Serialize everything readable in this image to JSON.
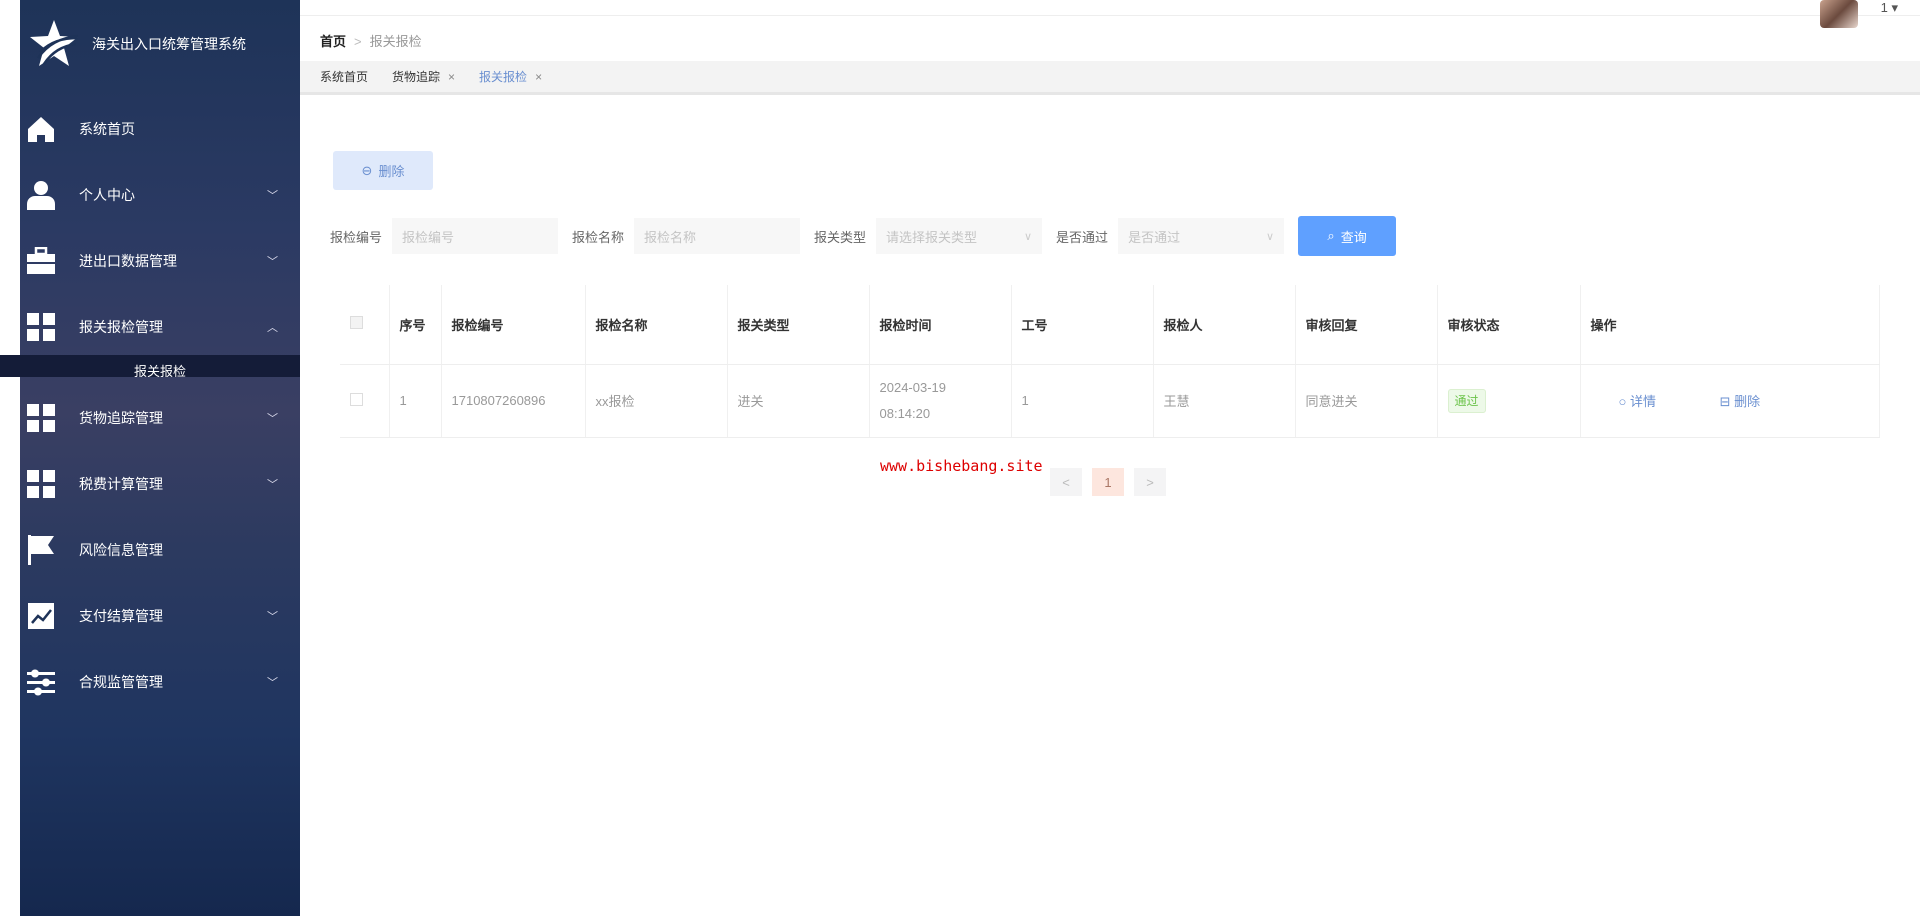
{
  "app": {
    "title": "海关出入口统筹管理系统"
  },
  "sidebar": {
    "items": [
      {
        "label": "系统首页",
        "icon": "home-icon"
      },
      {
        "label": "个人中心",
        "icon": "user-icon"
      },
      {
        "label": "进出口数据管理",
        "icon": "briefcase-icon"
      },
      {
        "label": "报关报检管理",
        "icon": "grid-icon"
      },
      {
        "label": "货物追踪管理",
        "icon": "grid-icon"
      },
      {
        "label": "税费计算管理",
        "icon": "grid-icon"
      },
      {
        "label": "风险信息管理",
        "icon": "flag-icon"
      },
      {
        "label": "支付结算管理",
        "icon": "chart-icon"
      },
      {
        "label": "合规监管管理",
        "icon": "sliders-icon"
      }
    ],
    "submenu": "报关报检"
  },
  "header": {
    "user": "1 ▾"
  },
  "breadcrumb": {
    "home": "首页",
    "sep": ">",
    "current": "报关报检"
  },
  "tabs": [
    {
      "label": "系统首页"
    },
    {
      "label": "货物追踪",
      "close": "×"
    },
    {
      "label": "报关报检",
      "close": "×"
    }
  ],
  "toolbar": {
    "delete": "删除"
  },
  "search": {
    "f1_label": "报检编号",
    "f1_ph": "报检编号",
    "f2_label": "报检名称",
    "f2_ph": "报检名称",
    "f3_label": "报关类型",
    "f3_ph": "请选择报关类型",
    "f4_label": "是否通过",
    "f4_ph": "是否通过",
    "query": "查询"
  },
  "table": {
    "headers": [
      "序号",
      "报检编号",
      "报检名称",
      "报关类型",
      "报检时间",
      "工号",
      "报检人",
      "审核回复",
      "审核状态",
      "操作"
    ],
    "rows": [
      {
        "idx": "1",
        "code": "1710807260896",
        "name": "xx报检",
        "type": "进关",
        "time": "2024-03-19 08:14:20",
        "emp": "1",
        "person": "王慧",
        "reply": "同意进关",
        "status": "通过",
        "detail": "详情",
        "del": "删除"
      }
    ]
  },
  "watermark": "www.bishebang.site",
  "pagination": {
    "prev": "<",
    "page": "1",
    "next": ">"
  }
}
